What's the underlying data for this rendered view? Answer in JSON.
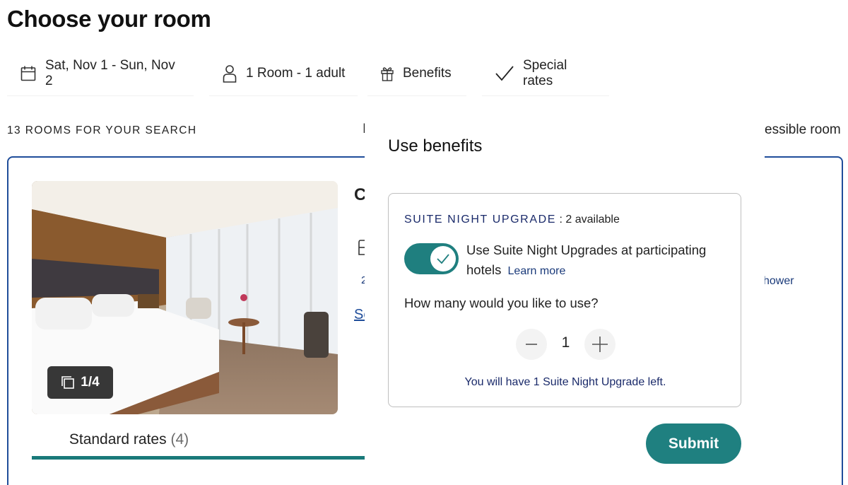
{
  "page": {
    "title": "Choose your room"
  },
  "filters": {
    "dates": "Sat, Nov 1 - Sun, Nov 2",
    "room": "1 Room - 1 adult",
    "benefits": "Benefits",
    "special_rates": "Special rates"
  },
  "results": {
    "count_label": "13 ROOMS FOR YOUR SEARCH",
    "accessible_fragment": "essible room",
    "cut_fragment": "I"
  },
  "room_card": {
    "photo_counter": "1/4",
    "title_fragment": "C",
    "line_fragment": "2",
    "link_fragment": "Se",
    "amenity_fragment": "hower",
    "rate_tab": {
      "label": "Standard rates",
      "count": "(4)"
    }
  },
  "benefits_popover": {
    "title": "Use benefits",
    "suite_night": {
      "name": "SUITE NIGHT UPGRADE",
      "separator": " : ",
      "available": "2 available",
      "toggle_on": true,
      "toggle_text": "Use Suite Night Upgrades at participating hotels",
      "learn_more": "Learn more",
      "question": "How many would you like to use?",
      "quantity": "1",
      "remaining_text": "You will have 1 Suite Night Upgrade left."
    },
    "submit_label": "Submit"
  },
  "colors": {
    "accent_teal": "#1f8080",
    "card_border": "#1f4d9a",
    "navy_text": "#1a2a6a"
  },
  "icons": [
    "calendar-icon",
    "person-icon",
    "gift-icon",
    "checkmark-icon",
    "gallery-icon",
    "check-icon",
    "minus-icon",
    "plus-icon"
  ]
}
